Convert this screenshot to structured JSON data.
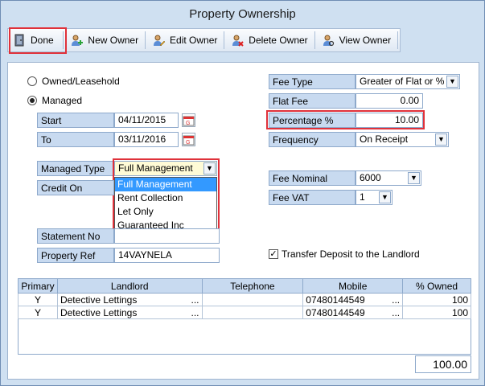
{
  "window": {
    "title": "Property Ownership"
  },
  "toolbar": {
    "done": "Done",
    "new_owner": "New Owner",
    "edit_owner": "Edit Owner",
    "delete_owner": "Delete Owner",
    "view_owner": "View Owner"
  },
  "ownership": {
    "owned_label": "Owned/Leasehold",
    "managed_label": "Managed",
    "selected": "Managed"
  },
  "dates": {
    "start_label": "Start",
    "start_value": "04/11/2015",
    "to_label": "To",
    "to_value": "03/11/2016"
  },
  "managed_type": {
    "label": "Managed Type",
    "value": "Full Management",
    "options": [
      "Full Management",
      "Rent Collection",
      "Let Only",
      "Guaranteed Inc"
    ]
  },
  "credit_on": {
    "label": "Credit On"
  },
  "statement_no": {
    "label": "Statement No",
    "value": ""
  },
  "property_ref": {
    "label": "Property Ref",
    "value": "14VAYNELA"
  },
  "fees": {
    "fee_type_label": "Fee Type",
    "fee_type_value": "Greater of Flat or %",
    "flat_fee_label": "Flat Fee",
    "flat_fee_value": "0.00",
    "percentage_label": "Percentage %",
    "percentage_value": "10.00",
    "frequency_label": "Frequency",
    "frequency_value": "On Receipt",
    "fee_nominal_label": "Fee Nominal",
    "fee_nominal_value": "6000",
    "fee_vat_label": "Fee VAT",
    "fee_vat_value": "1"
  },
  "transfer_deposit": {
    "label": "Transfer Deposit to the Landlord",
    "checked": true
  },
  "grid": {
    "columns": [
      "Primary",
      "Landlord",
      "Telephone",
      "Mobile",
      "% Owned"
    ],
    "rows": [
      {
        "primary": "Y",
        "landlord": "Detective Lettings",
        "telephone": "",
        "mobile": "07480144549",
        "owned": "100"
      },
      {
        "primary": "Y",
        "landlord": "Detective Lettings",
        "telephone": "",
        "mobile": "07480144549",
        "owned": "100"
      }
    ],
    "ellipsis": "...",
    "total": "100.00"
  }
}
